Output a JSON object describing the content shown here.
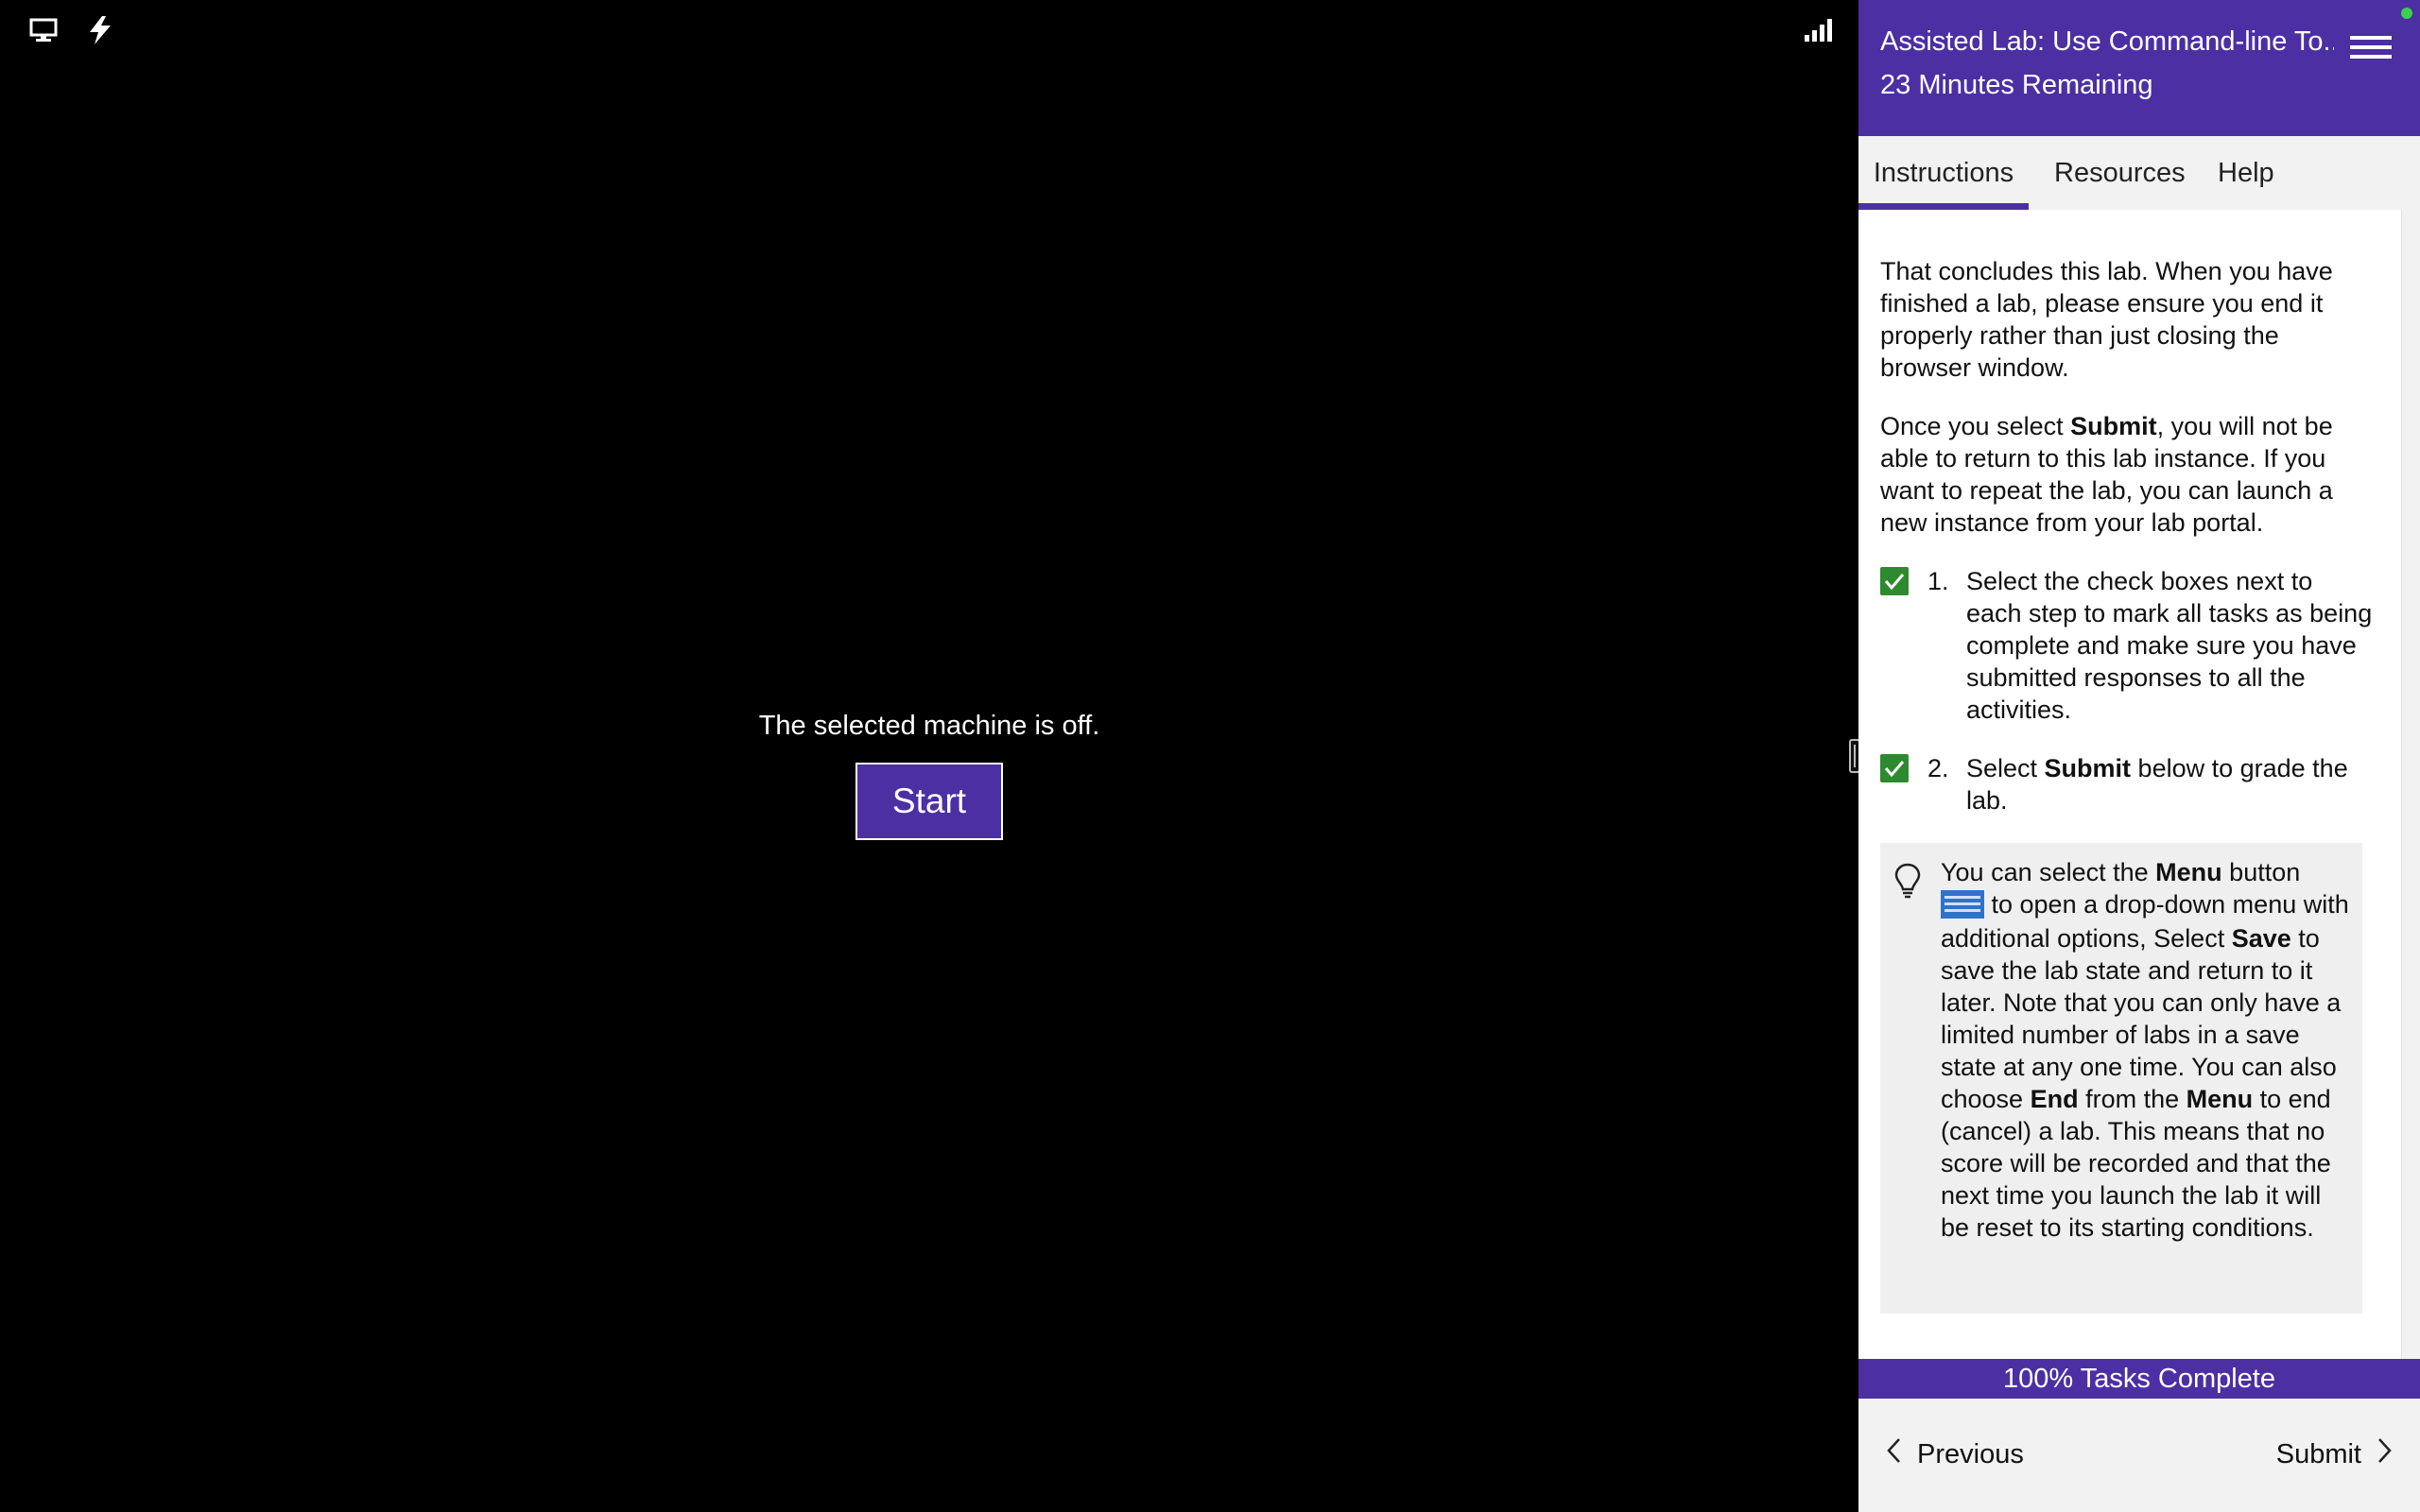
{
  "vm": {
    "status_message": "The selected machine is off.",
    "start_label": "Start"
  },
  "header": {
    "lab_title": "Assisted Lab: Use Command-line To...",
    "time_remaining": "23 Minutes Remaining"
  },
  "tabs": [
    {
      "label": "Instructions",
      "active": true
    },
    {
      "label": "Resources"
    },
    {
      "label": "Help"
    }
  ],
  "content": {
    "para1": "That concludes this lab. When you have finished a lab, please ensure you end it properly rather than just closing the browser window.",
    "para2_pre": "Once you select ",
    "para2_bold": "Submit",
    "para2_post": ", you will not be able to return to this lab instance. If you want to repeat the lab, you can launch a new instance from your lab portal.",
    "steps": [
      {
        "number": "1.",
        "text": "Select the check boxes next to each step to mark all tasks as being complete and make sure you have submitted responses to all the activities.",
        "checked": true
      },
      {
        "number": "2.",
        "text_pre": "Select ",
        "text_bold": "Submit",
        "text_post": " below to grade the lab.",
        "checked": true
      }
    ],
    "tip": {
      "t1": "You can select the ",
      "b1": "Menu",
      "t2": " button ",
      "t3": " to open a drop-down menu with additional options, Select ",
      "b2": "Save",
      "t4": " to save the lab state and return to it later. Note that you can only have a limited number of labs in a save state at any one time. You can also choose ",
      "b3": "End",
      "t5": " from the ",
      "b4": "Menu",
      "t6": " to end (cancel) a lab. This means that no score will be recorded and that the next time you launch the lab it will be reset to its starting conditions."
    }
  },
  "progress": {
    "label": "100% Tasks Complete",
    "fraction": 1.0
  },
  "footer": {
    "previous_label": "Previous",
    "submit_label": "Submit"
  },
  "colors": {
    "accent": "#4b2fa3",
    "check": "#2e8a2e",
    "status_dot": "#3ecf4c"
  },
  "icons": [
    "monitor-icon",
    "power-icon",
    "signal-icon",
    "menu-icon",
    "lightbulb-icon",
    "checkbox-checked-icon",
    "chevron-left-icon",
    "chevron-right-icon"
  ]
}
